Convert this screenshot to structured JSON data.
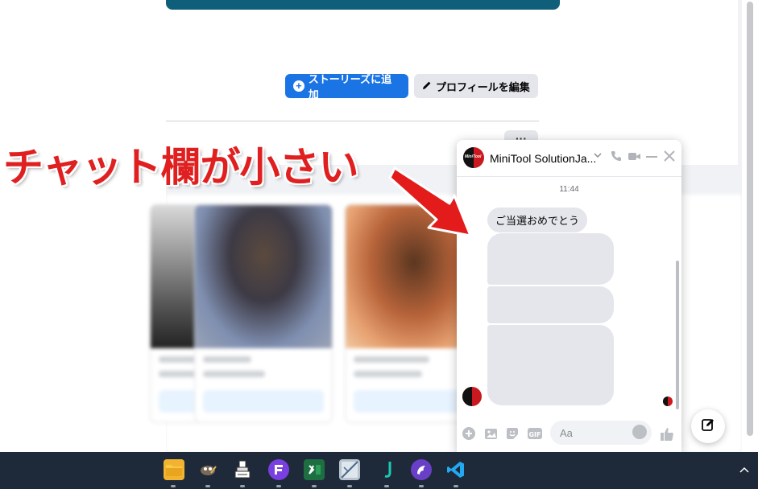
{
  "profile": {
    "add_story_label": "ストーリーズに追加",
    "edit_profile_label": "プロフィールを編集",
    "more_label": "···"
  },
  "annotation": {
    "text": "チャット欄が小さい"
  },
  "chat": {
    "title": "MiniTool SolutionJa...",
    "timestamp": "11:44",
    "message": "ご当選おめでとう",
    "input_placeholder": "Aa",
    "avatar_text": "MiniTool"
  },
  "colors": {
    "primary": "#1b74e4",
    "annotation": "#e02020",
    "taskbar": "#1e2a3a"
  },
  "taskbar": {
    "apps": [
      "file-explorer",
      "gimp",
      "stamp-app",
      "floorp-browser",
      "excel",
      "image-viewer",
      "joplin",
      "ferdium",
      "vscode"
    ]
  }
}
